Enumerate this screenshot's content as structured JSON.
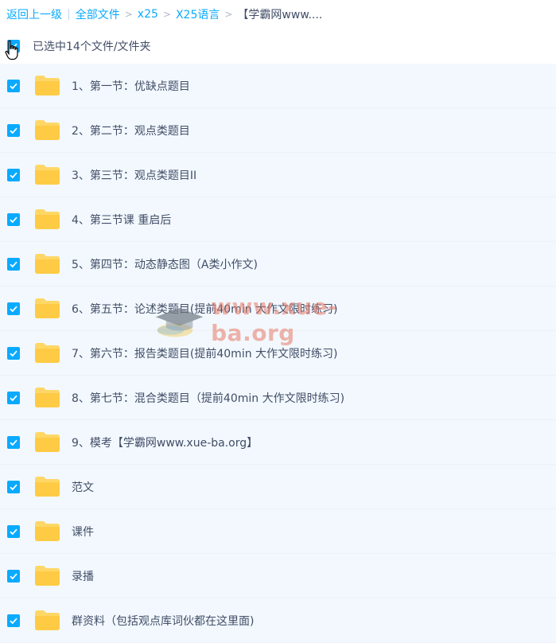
{
  "breadcrumb": {
    "back": "返回上一级",
    "all_files": "全部文件",
    "level1": "x25",
    "level2": "X25语言",
    "current": "【学霸网www...."
  },
  "selection": {
    "status_text": "已选中14个文件/文件夹",
    "checked": true
  },
  "files": [
    {
      "name": "1、第一节：优缺点题目",
      "checked": true
    },
    {
      "name": "2、第二节：观点类题目",
      "checked": true
    },
    {
      "name": "3、第三节：观点类题目II",
      "checked": true
    },
    {
      "name": "4、第三节课 重启后",
      "checked": true
    },
    {
      "name": "5、第四节：动态静态图（A类小作文)",
      "checked": true
    },
    {
      "name": "6、第五节：论述类题目(提前40min 大作文限时练习)",
      "checked": true
    },
    {
      "name": "7、第六节：报告类题目(提前40min 大作文限时练习)",
      "checked": true
    },
    {
      "name": "8、第七节：混合类题目（提前40min 大作文限时练习)",
      "checked": true
    },
    {
      "name": "9、模考【学霸网www.xue-ba.org】",
      "checked": true
    },
    {
      "name": "范文",
      "checked": true
    },
    {
      "name": "课件",
      "checked": true
    },
    {
      "name": "录播",
      "checked": true
    },
    {
      "name": "群资料（包括观点库词伙都在这里面)",
      "checked": true
    }
  ],
  "watermark": {
    "text": "www.xue-ba.org"
  },
  "colors": {
    "accent": "#09aaff",
    "row_bg": "#f2f8fe",
    "folder": "#ffd766",
    "text": "#424e67"
  }
}
